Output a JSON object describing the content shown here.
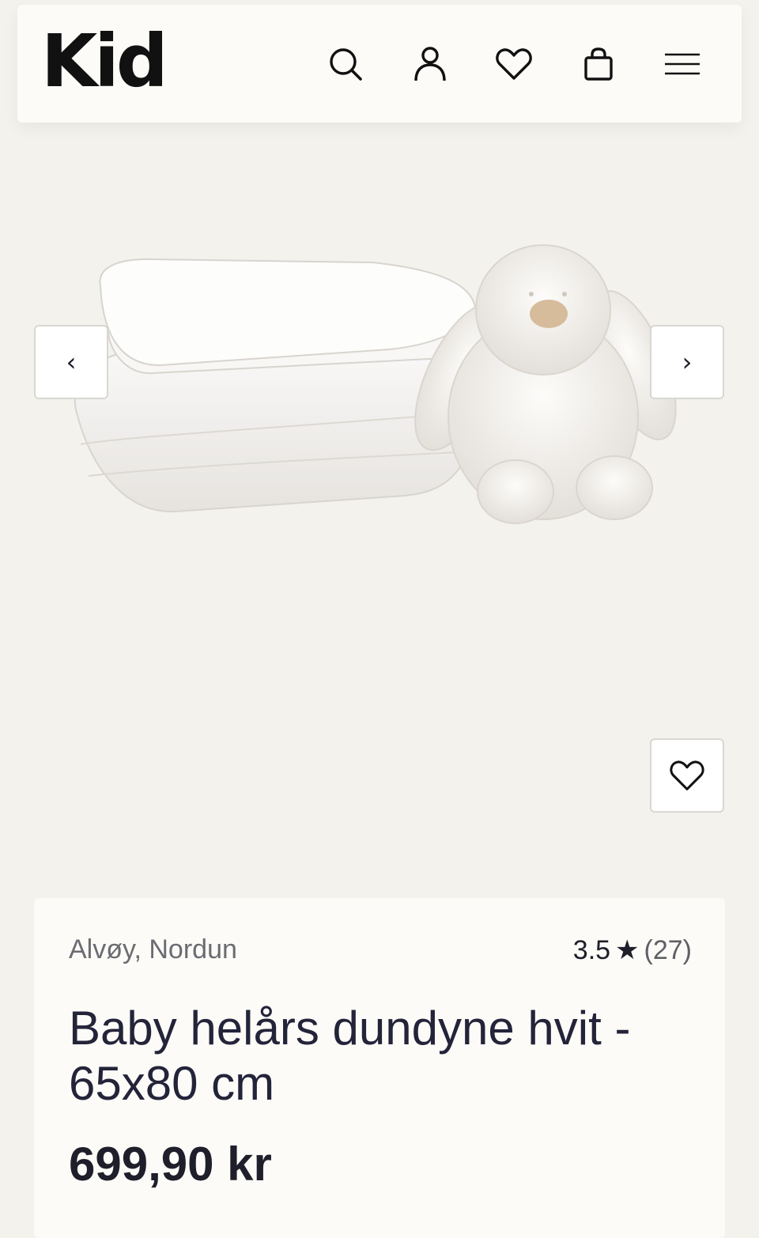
{
  "header": {
    "logo": "Kid",
    "icons": [
      "search-icon",
      "user-icon",
      "heart-icon",
      "bag-icon",
      "menu-icon"
    ]
  },
  "gallery": {
    "prev_label": "‹",
    "next_label": "›"
  },
  "product": {
    "brand": "Alvøy, Nordun",
    "rating": "3.5",
    "rating_star": "★",
    "review_count": "(27)",
    "title": "Baby helårs dundyne hvit - 65x80 cm",
    "price": "699,90 kr"
  },
  "colors": {
    "background": "#f4f2ec",
    "card": "#fcfbf8",
    "text": "#1f1f2b"
  }
}
